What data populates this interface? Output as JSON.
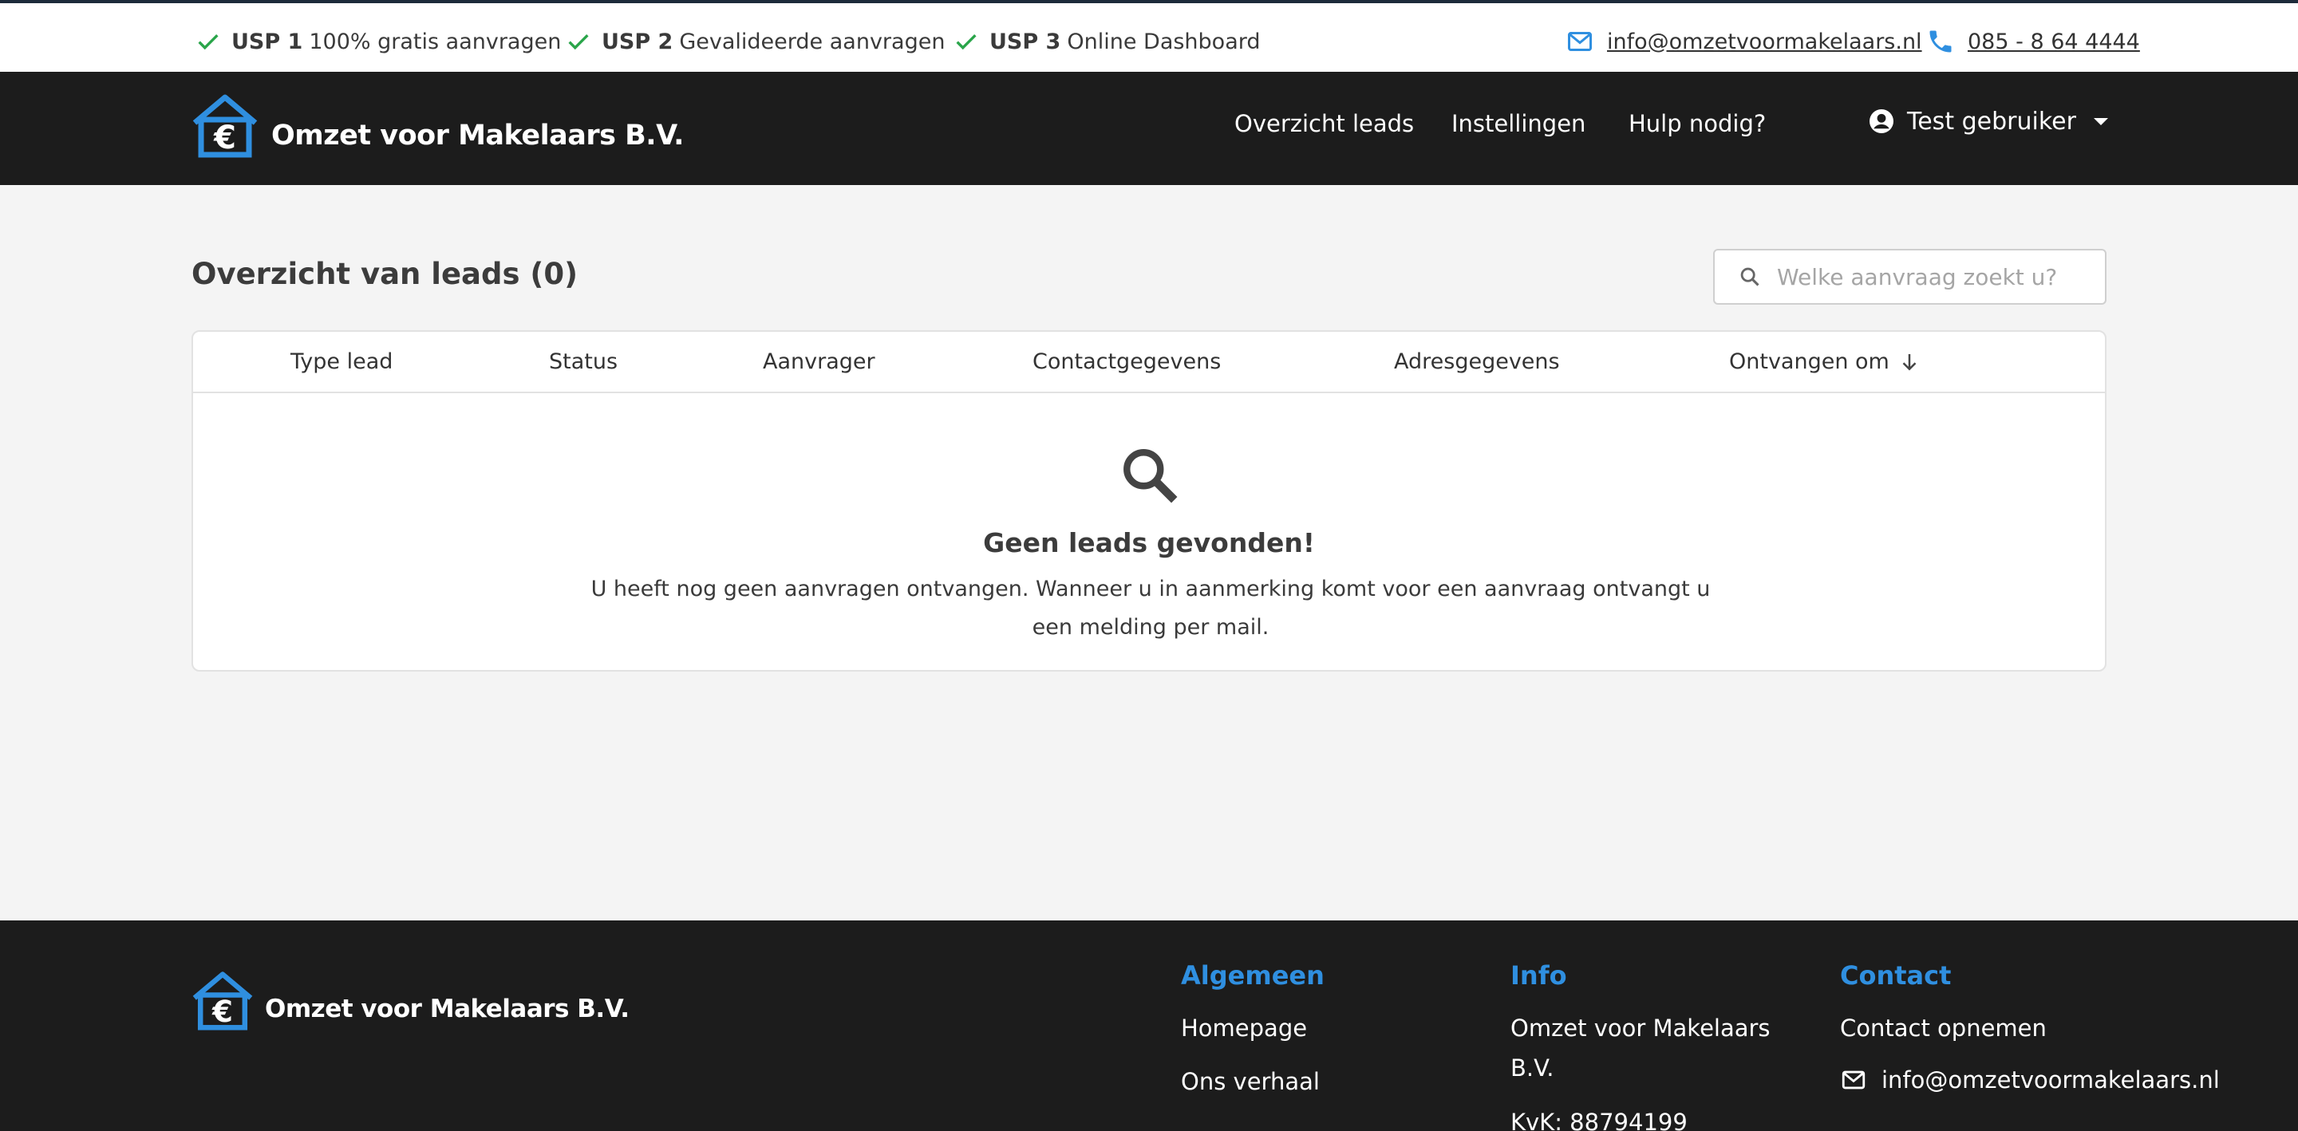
{
  "usp": [
    {
      "label": "USP 1",
      "text": "100% gratis aanvragen"
    },
    {
      "label": "USP 2",
      "text": "Gevalideerde aanvragen"
    },
    {
      "label": "USP 3",
      "text": "Online Dashboard"
    }
  ],
  "contact_top": {
    "email": "info@omzetvoormakelaars.nl",
    "phone": "085 - 8 64 4444"
  },
  "brand": {
    "name": "Omzet voor Makelaars B.V.",
    "accent": "#2f8fe0"
  },
  "nav": {
    "items": [
      "Overzicht leads",
      "Instellingen",
      "Hulp nodig?"
    ],
    "user": "Test gebruiker"
  },
  "main": {
    "title": "Overzicht van leads (0)",
    "search_placeholder": "Welke aanvraag zoekt u?",
    "columns": [
      "Type lead",
      "Status",
      "Aanvrager",
      "Contactgegevens",
      "Adresgegevens",
      "Ontvangen om"
    ],
    "empty_title": "Geen leads gevonden!",
    "empty_text": "U heeft nog geen aanvragen ontvangen. Wanneer u in aanmerking komt voor een aanvraag ontvangt u een melding per mail."
  },
  "footer": {
    "algemeen": {
      "heading": "Algemeen",
      "items": [
        "Homepage",
        "Ons verhaal"
      ]
    },
    "info": {
      "heading": "Info",
      "company_line1": "Omzet voor Makelaars",
      "company_line2": "B.V.",
      "kvk": "KvK: 88794199"
    },
    "contact": {
      "heading": "Contact",
      "opnemen": "Contact opnemen",
      "email": "info@omzetvoormakelaars.nl"
    }
  },
  "icons": {
    "check": "check-icon",
    "mail": "mail-icon",
    "phone": "phone-icon",
    "user": "user-circle-icon",
    "search": "search-icon",
    "sort": "arrow-down-icon",
    "logo": "house-euro-icon"
  }
}
